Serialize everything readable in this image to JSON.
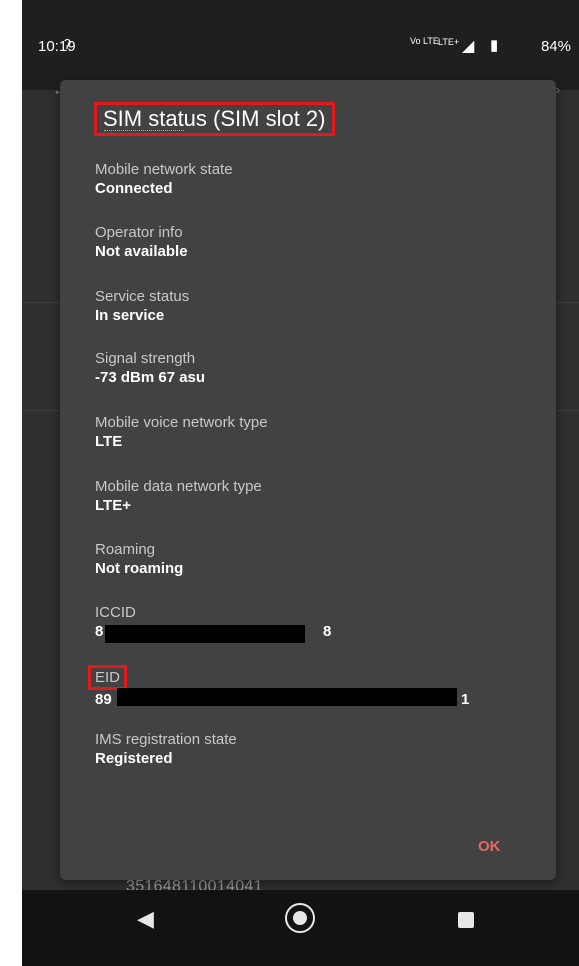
{
  "statusbar": {
    "time": "10:19",
    "battery_percent": "84%",
    "network_icons": [
      "vowifi-lte-icon",
      "lte-plus-icon",
      "signal-icon",
      "battery-icon"
    ],
    "lte_icon_text": "Vo LTE",
    "lte_plus_text": "LTE+"
  },
  "background": {
    "imei_text": "351648110014041"
  },
  "dialog": {
    "title": "SIM status (SIM slot 2)",
    "items": [
      {
        "label": "Mobile network state",
        "value": "Connected"
      },
      {
        "label": "Operator info",
        "value": "Not available"
      },
      {
        "label": "Service status",
        "value": "In service"
      },
      {
        "label": "Signal strength",
        "value": "-73 dBm 67 asu"
      },
      {
        "label": "Mobile voice network type",
        "value": "LTE"
      },
      {
        "label": "Mobile data network type",
        "value": "LTE+"
      },
      {
        "label": "Roaming",
        "value": "Not roaming"
      },
      {
        "label": "ICCID",
        "value_prefix": "8",
        "value_suffix": "8"
      },
      {
        "label": "EID",
        "value_prefix": "89",
        "value_suffix": "1"
      },
      {
        "label": "IMS registration state",
        "value": "Registered"
      }
    ],
    "ok_label": "OK"
  },
  "colors": {
    "highlight": "#e01b1b",
    "ok_button": "#e06a6a",
    "dialog_bg": "#424242"
  }
}
